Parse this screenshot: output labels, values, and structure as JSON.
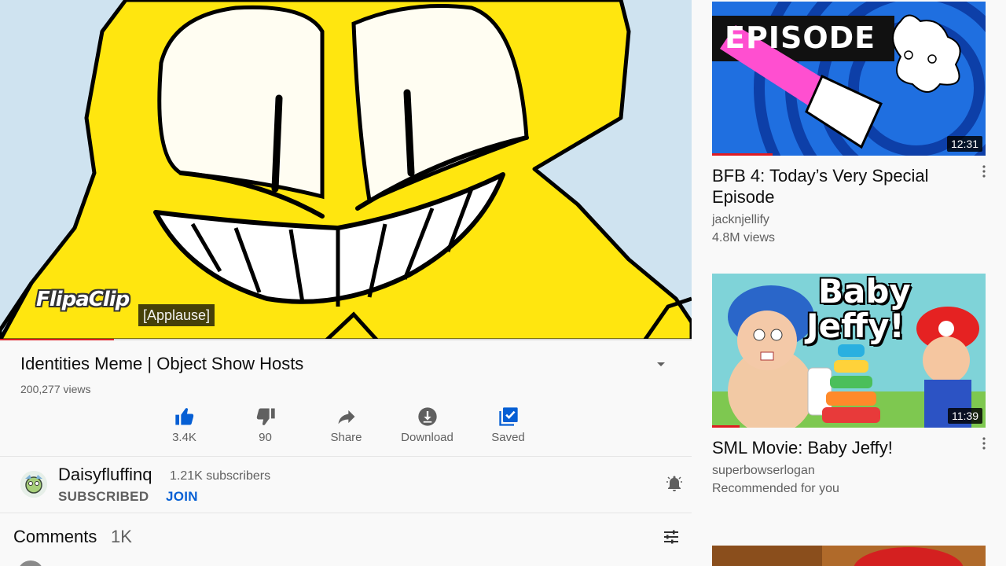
{
  "player": {
    "watermark": "FlipaClip",
    "caption": "[Applause]",
    "progress_fraction": 0.165
  },
  "video": {
    "title": "Identities Meme | Object Show Hosts",
    "views": "200,277 views"
  },
  "actions": [
    {
      "icon": "thumbs-up-icon",
      "label": "3.4K",
      "active": true
    },
    {
      "icon": "thumbs-down-icon",
      "label": "90"
    },
    {
      "icon": "share-icon",
      "label": "Share"
    },
    {
      "icon": "download-icon",
      "label": "Download"
    },
    {
      "icon": "saved-icon",
      "label": "Saved",
      "active": true
    }
  ],
  "channel": {
    "name": "Daisyfluffinq",
    "subscribers": "1.21K subscribers",
    "subscribed_label": "SUBSCRIBED",
    "join_label": "JOIN"
  },
  "comments": {
    "label": "Comments",
    "count": "1K"
  },
  "recommendations": [
    {
      "thumb_text": "EPISODE",
      "duration": "12:31",
      "title": "BFB 4: Today’s Very Special Episode",
      "channel": "jacknjellify",
      "meta": "4.8M views",
      "watched_fraction": 0.22
    },
    {
      "thumb_text_1": "Baby",
      "thumb_text_2": "Jeffy!",
      "duration": "11:39",
      "title": "SML Movie: Baby Jeffy!",
      "channel": "superbowserlogan",
      "meta": "Recommended for you",
      "watched_fraction": 0.1
    }
  ],
  "colors": {
    "accent_blue": "#065fd4",
    "progress_red": "#e01b22",
    "secondary_text": "#606060"
  }
}
